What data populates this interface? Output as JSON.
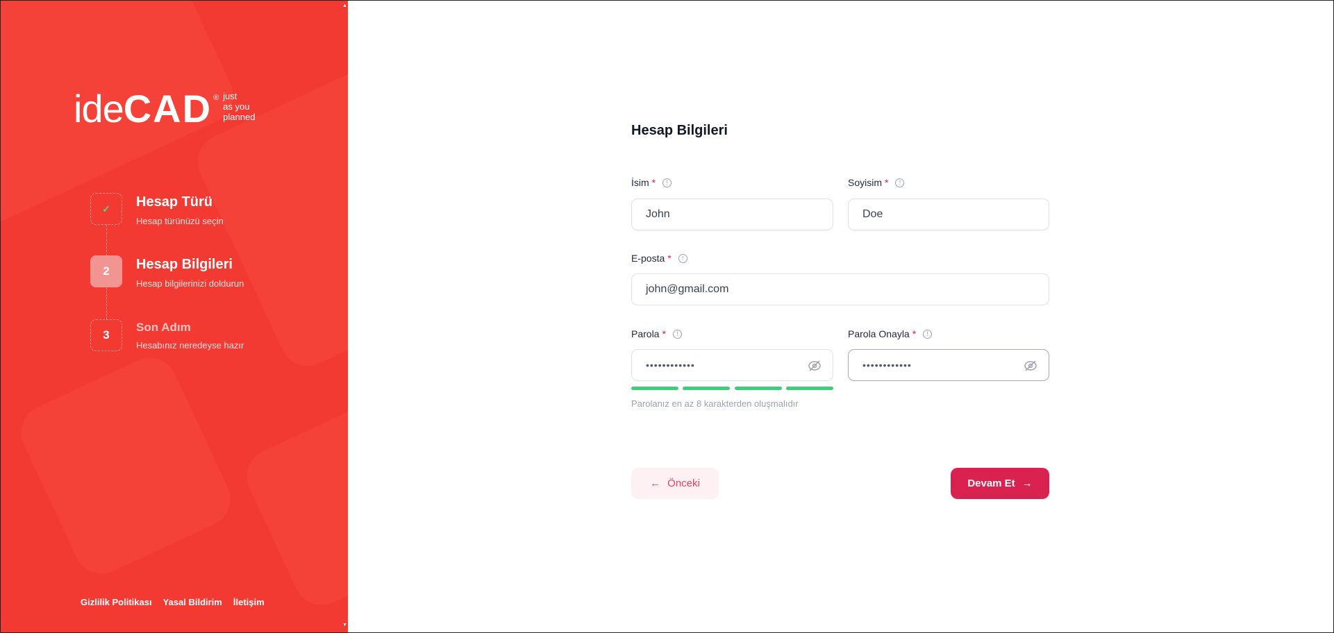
{
  "brand": {
    "logo_light": "ide",
    "logo_bold": "CAD",
    "registered": "®",
    "tagline": [
      "just",
      "as you",
      "planned"
    ]
  },
  "steps": [
    {
      "number": "✓",
      "title": "Hesap Türü",
      "subtitle": "Hesap türünüzü seçin",
      "state": "completed"
    },
    {
      "number": "2",
      "title": "Hesap Bilgileri",
      "subtitle": "Hesap bilgilerinizi doldurun",
      "state": "active"
    },
    {
      "number": "3",
      "title": "Son Adım",
      "subtitle": "Hesabınız neredeyse hazır",
      "state": "pending"
    }
  ],
  "footer": {
    "links": [
      "Gizlilik Politikası",
      "Yasal Bildirim",
      "İletişim"
    ]
  },
  "form": {
    "title": "Hesap Bilgileri",
    "required_mark": "*",
    "first_name": {
      "label": "İsim",
      "value": "John"
    },
    "last_name": {
      "label": "Soyisim",
      "value": "Doe"
    },
    "email": {
      "label": "E-posta",
      "value": "john@gmail.com"
    },
    "password": {
      "label": "Parola",
      "value": "••••••••••••",
      "strength": 4,
      "strength_max": 4
    },
    "password_confirm": {
      "label": "Parola Onayla",
      "value": "••••••••••••"
    },
    "hint": "Parolanız en az 8 karakterden oluşmalıdır",
    "prev_label": "Önceki",
    "next_label": "Devam Et"
  },
  "colors": {
    "panel": "#f23a33",
    "primary": "#d9224f",
    "strength": "#3fcc7b"
  }
}
